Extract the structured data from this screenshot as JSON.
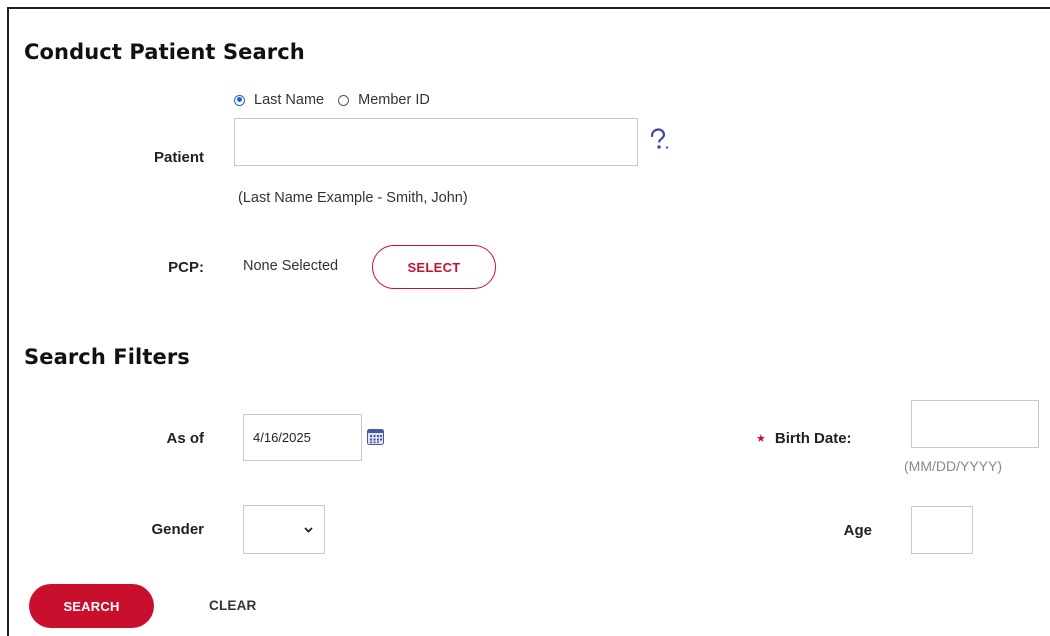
{
  "conduct": {
    "title": "Conduct Patient Search",
    "radio_last_name": "Last Name",
    "radio_member_id": "Member ID",
    "patient_label": "Patient",
    "patient_value": "",
    "help_icon": "?",
    "example": "(Last Name Example - Smith, John)",
    "pcp_label": "PCP:",
    "pcp_value": "None Selected",
    "select_button": "SELECT"
  },
  "filters": {
    "title": "Search Filters",
    "as_of_label": "As of",
    "as_of_value": "4/16/2025",
    "required_mark": "★",
    "birth_date_label": "Birth Date:",
    "birth_date_value": "",
    "birth_date_hint": "(MM/DD/YYYY)",
    "gender_label": "Gender",
    "gender_value": "",
    "age_label": "Age",
    "age_value": ""
  },
  "actions": {
    "search_button": "SEARCH",
    "clear_button": "CLEAR"
  },
  "colors": {
    "accent_red": "#c8102e",
    "radio_blue": "#1f63c6",
    "help_icon": "#3b4aa0",
    "calendar_icon": "#4a55a8"
  },
  "icons": [
    "help-icon",
    "calendar-icon",
    "chevron-down-icon",
    "required-star-icon"
  ]
}
